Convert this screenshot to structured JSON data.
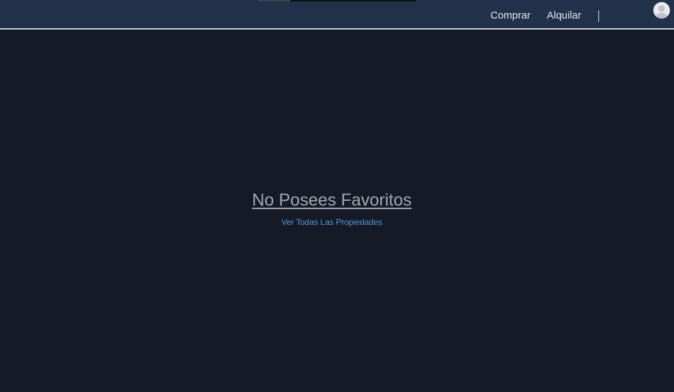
{
  "header": {
    "nav": {
      "buy_label": "Comprar",
      "rent_label": "Alquilar"
    },
    "avatar_icon": "user-avatar-icon"
  },
  "main": {
    "empty_title": "No Posees Favoritos",
    "see_all_link": "Ver Todas Las Propiedades"
  },
  "colors": {
    "header_bg": "#22324b",
    "page_bg": "#141b26",
    "link": "#5c95d8",
    "title": "#a2a7af"
  }
}
